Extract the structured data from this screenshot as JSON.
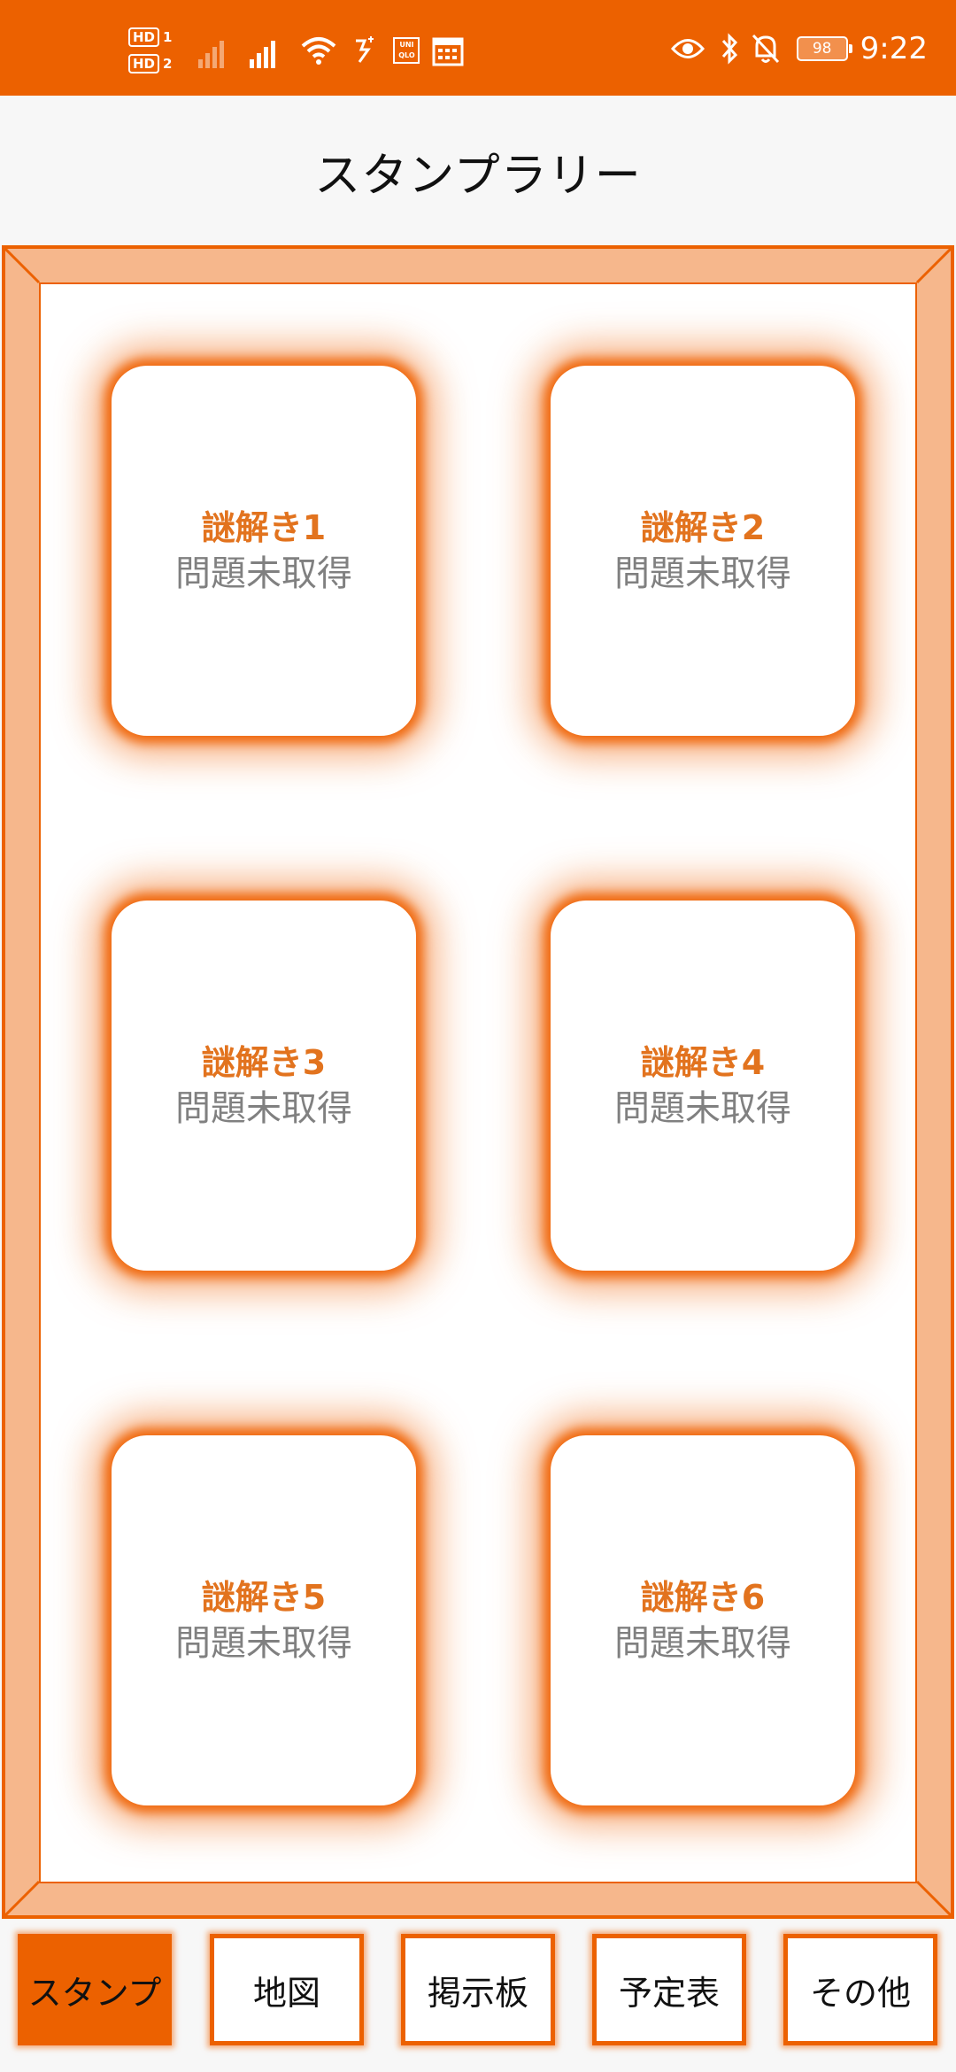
{
  "status_bar": {
    "hd1": "HD",
    "hd1_sub": "1",
    "hd2": "HD",
    "hd2_sub": "2",
    "uniqlo_top": "UNI",
    "uniqlo_bottom": "QLO",
    "battery": "98",
    "time": "9:22",
    "icons": [
      "signal-icon",
      "wifi-icon",
      "data-saver-icon",
      "uniqlo-icon",
      "calendar-icon",
      "eye-icon",
      "bluetooth-icon",
      "bell-off-icon",
      "battery-icon"
    ]
  },
  "header": {
    "title": "スタンプラリー"
  },
  "cards": [
    {
      "title": "謎解き1",
      "status": "問題未取得"
    },
    {
      "title": "謎解き2",
      "status": "問題未取得"
    },
    {
      "title": "謎解き3",
      "status": "問題未取得"
    },
    {
      "title": "謎解き4",
      "status": "問題未取得"
    },
    {
      "title": "謎解き5",
      "status": "問題未取得"
    },
    {
      "title": "謎解き6",
      "status": "問題未取得"
    }
  ],
  "nav": {
    "items": [
      {
        "label": "スタンプ",
        "active": true
      },
      {
        "label": "地図",
        "active": false
      },
      {
        "label": "掲示板",
        "active": false
      },
      {
        "label": "予定表",
        "active": false
      },
      {
        "label": "その他",
        "active": false
      }
    ]
  },
  "colors": {
    "accent": "#ec6100",
    "card_title": "#e2731e",
    "card_status": "#808080",
    "frame_fill": "#f6b78c"
  }
}
